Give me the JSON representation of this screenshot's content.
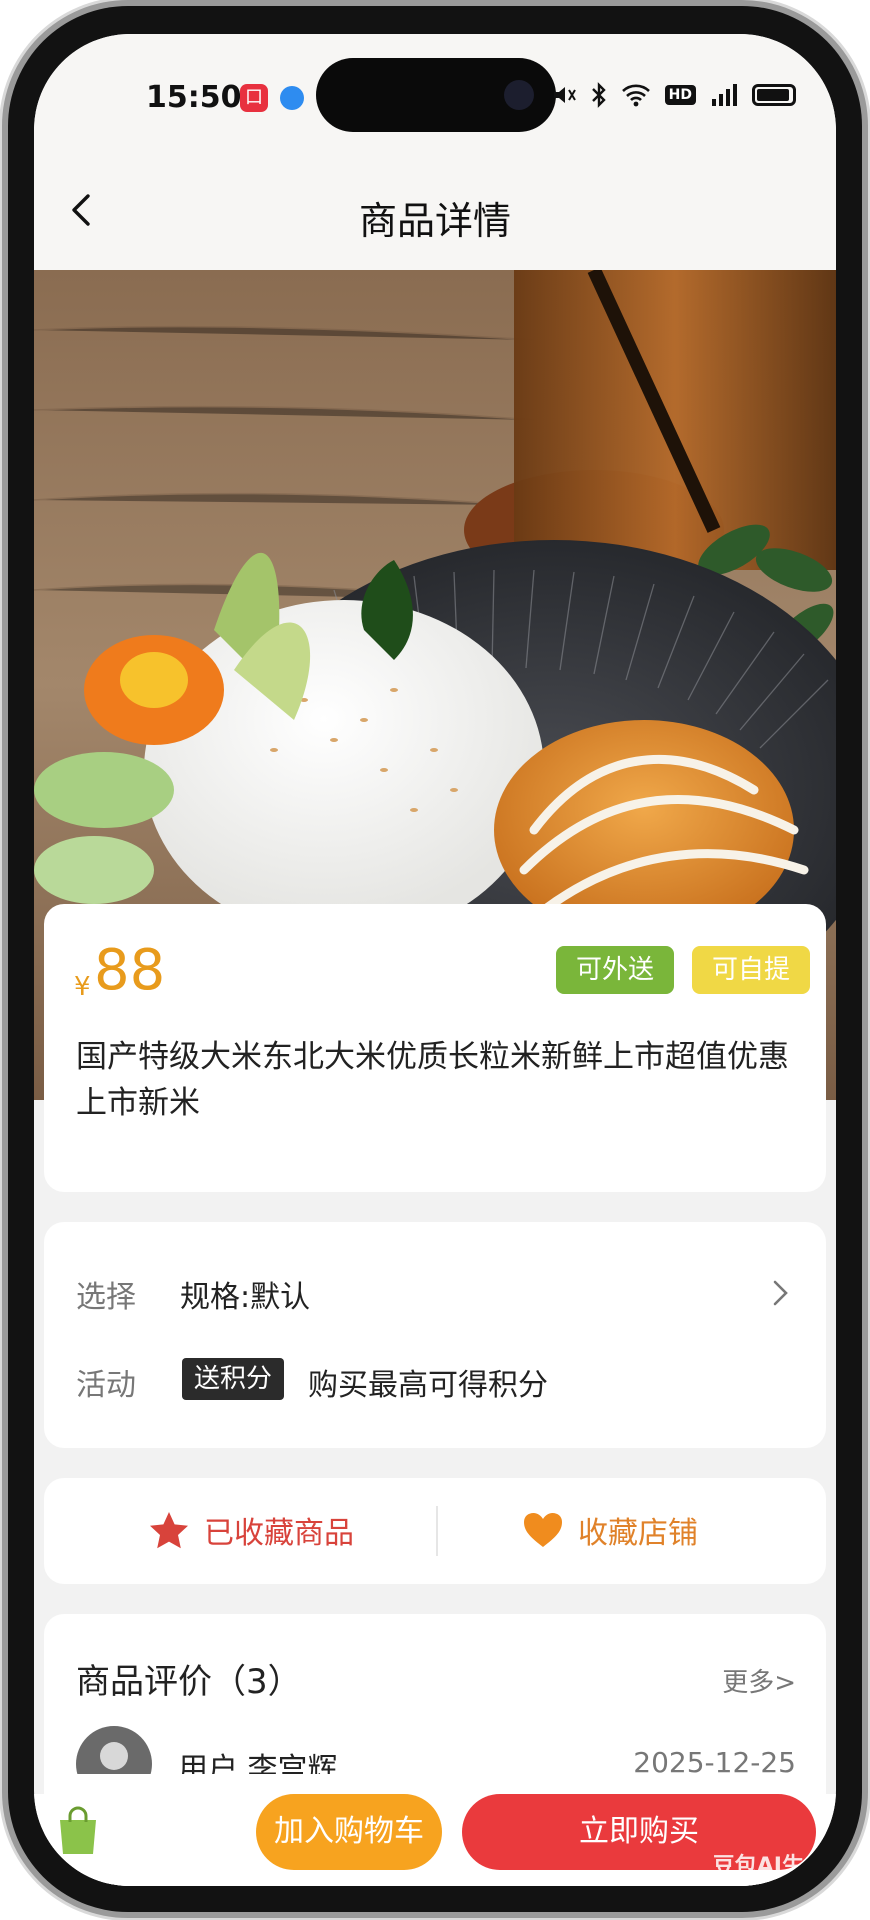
{
  "status_bar": {
    "time": "15:50",
    "notification_badge": "口",
    "icons": [
      "mute-icon",
      "bluetooth-icon",
      "wifi-icon",
      "hd-icon",
      "signal-icon",
      "battery-icon"
    ],
    "hd_label": "HD"
  },
  "nav": {
    "title": "商品详情",
    "back_icon": "chevron-left-icon"
  },
  "product": {
    "currency": "¥",
    "price": "88",
    "tags": [
      "可外送",
      "可自提"
    ],
    "title": "国产特级大米东北大米优质长粒米新鲜上市超值优惠上市新米"
  },
  "options": {
    "select_label": "选择",
    "select_value": "规格:默认",
    "activity_label": "活动",
    "activity_badge": "送积分",
    "activity_text": "购买最高可得积分"
  },
  "favorites": {
    "product_label": "已收藏商品",
    "store_label": "收藏店铺"
  },
  "reviews": {
    "title": "商品评价（3）",
    "more": "更多>",
    "user": "用户 李宫辉",
    "date": "2025-12-25"
  },
  "bottom": {
    "cart": "加入购物车",
    "buy": "立即购买",
    "watermark": "豆包AI生成"
  },
  "colors": {
    "price": "#e89b1c",
    "tag_green": "#7ab63a",
    "tag_yellow": "#f0d845",
    "fav_product": "#d8433b",
    "fav_store": "#e0822a",
    "cart_button": "#f7a31f",
    "buy_button": "#ea3a3d"
  }
}
